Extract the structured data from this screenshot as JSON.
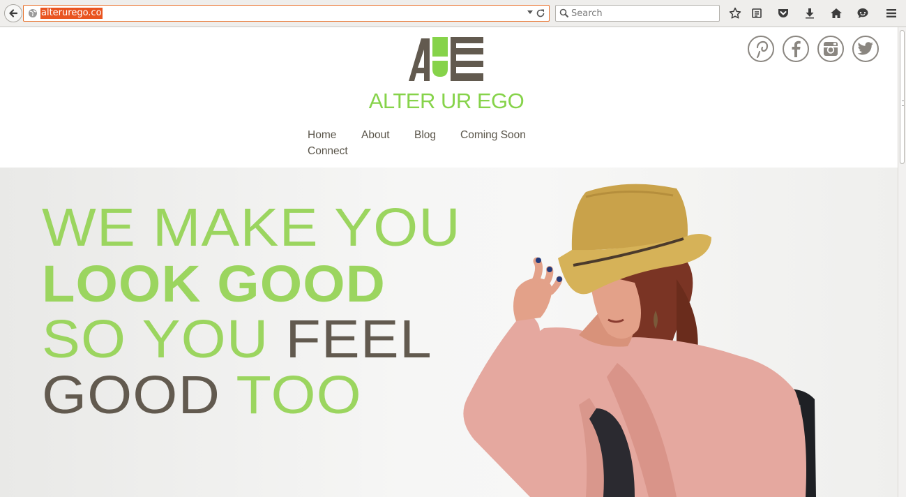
{
  "browser": {
    "url": "alterurego.co",
    "search_placeholder": "Search",
    "toolbar_icons": [
      "bookmark-star-icon",
      "reading-list-icon",
      "pocket-icon",
      "download-icon",
      "home-icon",
      "chat-icon",
      "menu-icon"
    ]
  },
  "site": {
    "brand_name": "ALTER UR EGO",
    "brand_color": "#86d34a",
    "dark_color": "#625a4f",
    "nav": [
      "Home",
      "About",
      "Blog",
      "Coming Soon",
      "Connect"
    ],
    "social": [
      "pinterest-icon",
      "facebook-icon",
      "instagram-icon",
      "twitter-icon"
    ]
  },
  "hero": {
    "line1": "WE MAKE YOU",
    "line2": "LOOK GOOD",
    "line3_green": "SO YOU",
    "line3_dark": "FEEL",
    "line4_dark": "GOOD",
    "line4_green": "TOO"
  }
}
